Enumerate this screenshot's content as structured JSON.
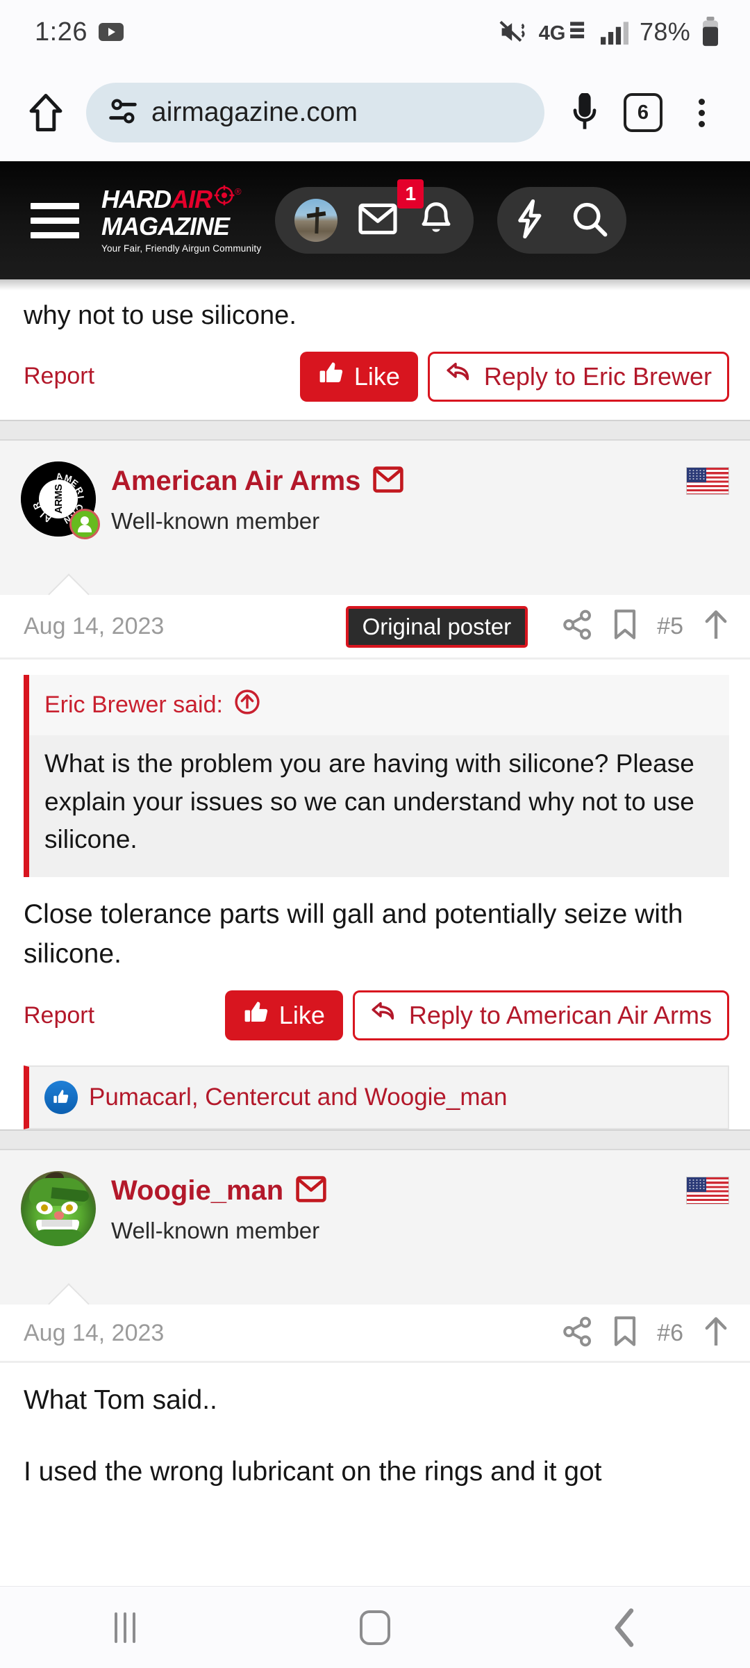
{
  "status_bar": {
    "time": "1:26",
    "youtube_icon": "youtube-play-icon",
    "mute_icon": "mute-vibrate-icon",
    "network": "4G LTE",
    "signal_icon": "signal-bars-icon",
    "battery_percent": "78%",
    "battery_icon": "battery-icon"
  },
  "browser": {
    "home_icon": "home-icon",
    "site_settings_icon": "site-settings-tune-icon",
    "url": "airmagazine.com",
    "mic_icon": "microphone-icon",
    "tab_count": "6",
    "menu_icon": "overflow-menu-icon"
  },
  "site_header": {
    "menu_icon": "hamburger-menu-icon",
    "logo": {
      "word1": "HARD",
      "word2": "AIR",
      "registered": "®",
      "word3": "MAGAZINE",
      "tagline": "Your Fair, Friendly Airgun Community",
      "target_icon": "crosshair-target-icon"
    },
    "nav": {
      "avatar": "user-avatar",
      "inbox_icon": "envelope-icon",
      "alerts_icon": "bell-icon",
      "alerts_count": "1",
      "whats_new_icon": "lightning-bolt-icon",
      "search_icon": "search-icon"
    }
  },
  "posts": [
    {
      "tail_text": "why not to use silicone.",
      "report_label": "Report",
      "like_label": "Like",
      "like_icon": "thumbs-up-icon",
      "reply_label": "Reply to Eric Brewer",
      "reply_icon": "reply-arrow-icon"
    },
    {
      "author": "American Air Arms",
      "author_title": "Well-known member",
      "mail_icon": "envelope-outline-icon",
      "flag_icon": "us-flag-icon",
      "online_icon": "online-status-icon",
      "avatar_alt": "american-air-arms-logo",
      "date": "Aug 14, 2023",
      "badge": "Original poster",
      "share_icon": "share-icon",
      "bookmark_icon": "bookmark-icon",
      "post_number": "#5",
      "jump_icon": "jump-to-top-arrow-icon",
      "quote": {
        "header": "Eric Brewer said:",
        "jump_icon": "quote-jump-icon",
        "text": "What is the problem you are having with silicone? Please explain your issues so we can understand why not to use silicone."
      },
      "body": "Close tolerance parts will gall and potentially seize with silicone.",
      "report_label": "Report",
      "like_label": "Like",
      "like_icon": "thumbs-up-icon",
      "reply_label": "Reply to American Air Arms",
      "reply_icon": "reply-arrow-icon",
      "likes": {
        "icon": "facebook-like-icon",
        "names": "Pumacarl, Centercut and Woogie_man"
      }
    },
    {
      "author": "Woogie_man",
      "author_title": "Well-known member",
      "mail_icon": "envelope-outline-icon",
      "flag_icon": "us-flag-icon",
      "avatar_alt": "woogie-man-green-character-avatar",
      "date": "Aug 14, 2023",
      "share_icon": "share-icon",
      "bookmark_icon": "bookmark-icon",
      "post_number": "#6",
      "jump_icon": "jump-to-top-arrow-icon",
      "body_line1": "What Tom said..",
      "body_line2": "I used the wrong lubricant on the rings and it got"
    }
  ],
  "system_nav": {
    "recents_icon": "recents-icon",
    "home_icon": "home-button-icon",
    "back_icon": "back-button-icon"
  },
  "colors": {
    "brand_red": "#d8151f",
    "link_red": "#b3182a",
    "header_black": "#141414"
  }
}
